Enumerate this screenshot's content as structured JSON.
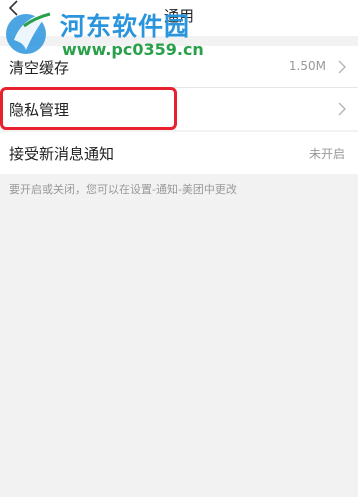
{
  "header": {
    "title": "通用",
    "back_icon": "chevron-left-icon"
  },
  "watermark": {
    "name": "河东软件园",
    "url": "www.pc0359.cn",
    "colors": {
      "name": "#2a95dd",
      "url": "#2aa04a"
    }
  },
  "settings": {
    "clear_cache": {
      "label": "清空缓存",
      "value": "1.50M"
    },
    "privacy": {
      "label": "隐私管理"
    },
    "notifications": {
      "label": "接受新消息通知",
      "value": "未开启"
    }
  },
  "hint": "要开启或关闭，您可以在设置-通知-美团中更改",
  "colors": {
    "highlight": "#e8212e",
    "background": "#f2f2f2"
  }
}
